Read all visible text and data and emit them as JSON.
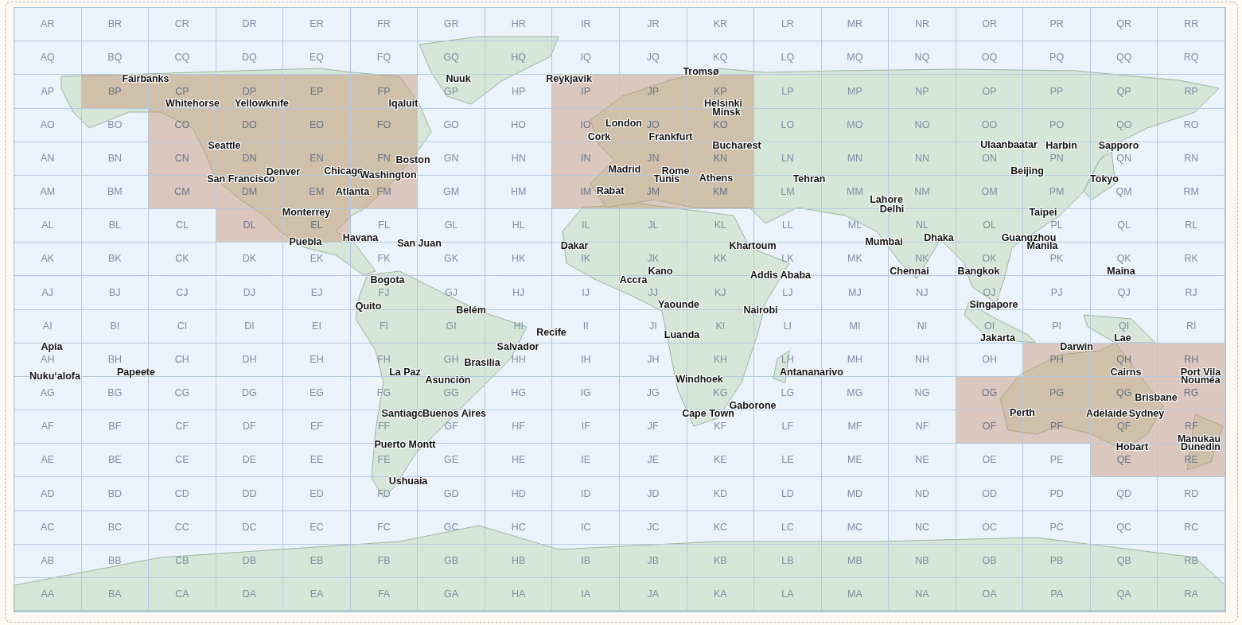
{
  "grid": {
    "rows": [
      {
        "labels": [
          "AR",
          "BR",
          "CR",
          "DR",
          "ER",
          "FR",
          "GR",
          "HR",
          "IR",
          "JR",
          "KR",
          "LR",
          "MR",
          "NR",
          "OR",
          "PR",
          "QR",
          "RR"
        ],
        "highlighted": [
          false,
          false,
          false,
          false,
          false,
          false,
          false,
          false,
          false,
          false,
          false,
          false,
          false,
          false,
          false,
          false,
          false,
          false
        ]
      },
      {
        "labels": [
          "AQ",
          "BQ",
          "CQ",
          "DQ",
          "EQ",
          "FQ",
          "GQ",
          "HQ",
          "IQ",
          "JQ",
          "KQ",
          "LQ",
          "MQ",
          "NQ",
          "OQ",
          "PQ",
          "QQ",
          "RQ"
        ],
        "highlighted": [
          false,
          false,
          false,
          false,
          false,
          false,
          false,
          false,
          false,
          false,
          false,
          false,
          false,
          false,
          false,
          false,
          false,
          false
        ]
      },
      {
        "labels": [
          "AP",
          "BP",
          "CP",
          "DP",
          "EP",
          "FP",
          "GP",
          "HP",
          "IP",
          "JP",
          "KP",
          "LP",
          "MP",
          "NP",
          "OP",
          "PP",
          "QP",
          "RP"
        ],
        "highlighted": [
          false,
          true,
          true,
          true,
          true,
          true,
          false,
          false,
          true,
          true,
          true,
          false,
          false,
          false,
          false,
          false,
          false,
          false
        ]
      },
      {
        "labels": [
          "AO",
          "BO",
          "CO",
          "DO",
          "EO",
          "FO",
          "GO",
          "HO",
          "IO",
          "JO",
          "KO",
          "LO",
          "MO",
          "NO",
          "OO",
          "PO",
          "QO",
          "RO"
        ],
        "highlighted": [
          false,
          false,
          true,
          true,
          true,
          true,
          false,
          false,
          true,
          true,
          true,
          false,
          false,
          false,
          false,
          false,
          false,
          false
        ]
      },
      {
        "labels": [
          "AN",
          "BN",
          "CN",
          "DN",
          "EN",
          "FN",
          "GN",
          "HN",
          "IN",
          "JN",
          "KN",
          "LN",
          "MN",
          "NN",
          "ON",
          "PN",
          "QN",
          "RN"
        ],
        "highlighted": [
          false,
          false,
          true,
          true,
          true,
          true,
          false,
          false,
          true,
          true,
          true,
          false,
          false,
          false,
          false,
          false,
          false,
          false
        ]
      },
      {
        "labels": [
          "AM",
          "BM",
          "CM",
          "DM",
          "EM",
          "FM",
          "GM",
          "HM",
          "IM",
          "JM",
          "KM",
          "LM",
          "MM",
          "NM",
          "OM",
          "PM",
          "QM",
          "RM"
        ],
        "highlighted": [
          false,
          false,
          true,
          true,
          true,
          true,
          false,
          false,
          true,
          true,
          true,
          false,
          false,
          false,
          false,
          false,
          false,
          false
        ]
      },
      {
        "labels": [
          "AL",
          "BL",
          "CL",
          "DL",
          "EL",
          "FL",
          "GL",
          "HL",
          "IL",
          "JL",
          "KL",
          "LL",
          "ML",
          "NL",
          "OL",
          "PL",
          "QL",
          "RL"
        ],
        "highlighted": [
          false,
          false,
          false,
          true,
          true,
          false,
          false,
          false,
          false,
          false,
          false,
          false,
          false,
          false,
          false,
          false,
          false,
          false
        ]
      },
      {
        "labels": [
          "AK",
          "BK",
          "CK",
          "DK",
          "EK",
          "FK",
          "GK",
          "HK",
          "IK",
          "JK",
          "KK",
          "LK",
          "MK",
          "NK",
          "OK",
          "PK",
          "QK",
          "RK"
        ],
        "highlighted": [
          false,
          false,
          false,
          false,
          false,
          false,
          false,
          false,
          false,
          false,
          false,
          false,
          false,
          false,
          false,
          false,
          false,
          false
        ]
      },
      {
        "labels": [
          "AJ",
          "BJ",
          "CJ",
          "DJ",
          "EJ",
          "FJ",
          "GJ",
          "HJ",
          "IJ",
          "JJ",
          "KJ",
          "LJ",
          "MJ",
          "NJ",
          "OJ",
          "PJ",
          "QJ",
          "RJ"
        ],
        "highlighted": [
          false,
          false,
          false,
          false,
          false,
          false,
          false,
          false,
          false,
          false,
          false,
          false,
          false,
          false,
          false,
          false,
          false,
          false
        ]
      },
      {
        "labels": [
          "AI",
          "BI",
          "CI",
          "DI",
          "EI",
          "FI",
          "GI",
          "HI",
          "II",
          "JI",
          "KI",
          "LI",
          "MI",
          "NI",
          "OI",
          "PI",
          "QI",
          "RI"
        ],
        "highlighted": [
          false,
          false,
          false,
          false,
          false,
          false,
          false,
          false,
          false,
          false,
          false,
          false,
          false,
          false,
          false,
          false,
          false,
          false
        ]
      },
      {
        "labels": [
          "AH",
          "BH",
          "CH",
          "DH",
          "EH",
          "FH",
          "GH",
          "HH",
          "IH",
          "JH",
          "KH",
          "LH",
          "MH",
          "NH",
          "OH",
          "PH",
          "QH",
          "RH"
        ],
        "highlighted": [
          false,
          false,
          false,
          false,
          false,
          false,
          false,
          false,
          false,
          false,
          false,
          false,
          false,
          false,
          false,
          true,
          true,
          true
        ]
      },
      {
        "labels": [
          "AG",
          "BG",
          "CG",
          "DG",
          "EG",
          "FG",
          "GG",
          "HG",
          "IG",
          "JG",
          "KG",
          "LG",
          "MG",
          "NG",
          "OG",
          "PG",
          "QG",
          "RG"
        ],
        "highlighted": [
          false,
          false,
          false,
          false,
          false,
          false,
          false,
          false,
          false,
          false,
          false,
          false,
          false,
          false,
          true,
          true,
          true,
          true
        ]
      },
      {
        "labels": [
          "AF",
          "BF",
          "CF",
          "DF",
          "EF",
          "FF",
          "GF",
          "HF",
          "IF",
          "JF",
          "KF",
          "LF",
          "MF",
          "NF",
          "OF",
          "PF",
          "QF",
          "RF"
        ],
        "highlighted": [
          false,
          false,
          false,
          false,
          false,
          false,
          false,
          false,
          false,
          false,
          false,
          false,
          false,
          false,
          true,
          true,
          true,
          true
        ]
      },
      {
        "labels": [
          "AE",
          "BE",
          "CE",
          "DE",
          "EE",
          "FE",
          "GE",
          "HE",
          "IE",
          "JE",
          "KE",
          "LE",
          "ME",
          "NE",
          "OE",
          "PE",
          "QE",
          "RE"
        ],
        "highlighted": [
          false,
          false,
          false,
          false,
          false,
          false,
          false,
          false,
          false,
          false,
          false,
          false,
          false,
          false,
          false,
          false,
          true,
          true
        ]
      },
      {
        "labels": [
          "AD",
          "BD",
          "CD",
          "DD",
          "ED",
          "FD",
          "GD",
          "HD",
          "ID",
          "JD",
          "KD",
          "LD",
          "MD",
          "ND",
          "OD",
          "PD",
          "QD",
          "RD"
        ],
        "highlighted": [
          false,
          false,
          false,
          false,
          false,
          false,
          false,
          false,
          false,
          false,
          false,
          false,
          false,
          false,
          false,
          false,
          false,
          false
        ]
      },
      {
        "labels": [
          "AC",
          "BC",
          "CC",
          "DC",
          "EC",
          "FC",
          "GC",
          "HC",
          "IC",
          "JC",
          "KC",
          "LC",
          "MC",
          "NC",
          "OC",
          "PC",
          "QC",
          "RC"
        ],
        "highlighted": [
          false,
          false,
          false,
          false,
          false,
          false,
          false,
          false,
          false,
          false,
          false,
          false,
          false,
          false,
          false,
          false,
          false,
          false
        ]
      },
      {
        "labels": [
          "AB",
          "BB",
          "CB",
          "DB",
          "EB",
          "FB",
          "GB",
          "HB",
          "IB",
          "JB",
          "KB",
          "LB",
          "MB",
          "NB",
          "OB",
          "PB",
          "QB",
          "RB"
        ],
        "highlighted": [
          false,
          false,
          false,
          false,
          false,
          false,
          false,
          false,
          false,
          false,
          false,
          false,
          false,
          false,
          false,
          false,
          false,
          false
        ]
      },
      {
        "labels": [
          "AA",
          "BA",
          "CA",
          "DA",
          "EA",
          "FA",
          "GA",
          "HA",
          "IA",
          "JA",
          "KA",
          "LA",
          "MA",
          "NA",
          "OA",
          "PA",
          "QA",
          "RA"
        ],
        "highlighted": [
          false,
          false,
          false,
          false,
          false,
          false,
          false,
          false,
          false,
          false,
          false,
          false,
          false,
          false,
          false,
          false,
          false,
          false
        ]
      }
    ]
  },
  "cities": [
    "Fairbanks",
    "Whitehorse",
    "Yellowknife",
    "Iqaluit",
    "Nuuk",
    "Reykjavik",
    "Tromsø",
    "Helsinki",
    "Cork",
    "London",
    "Minsk",
    "Frankfurt",
    "Seattle",
    "Bucharest",
    "Ulaanbaatar",
    "Harbin",
    "Chicago",
    "Boston",
    "Sapporo",
    "San Francisco",
    "Denver",
    "Washington",
    "Madrid",
    "Rome",
    "Tunis",
    "Athens",
    "Beijing",
    "Tehran",
    "Atlanta",
    "Rabat",
    "Tokyo",
    "Lahore",
    "Delhi",
    "Monterrey",
    "Taipei",
    "Puebla",
    "Havana",
    "San Juan",
    "Dakar",
    "Khartoum",
    "Mumbai",
    "Dhaka",
    "Guangzhou",
    "Manila",
    "Bogota",
    "Accra",
    "Kano",
    "Addis Ababa",
    "Chennai",
    "Bangkok",
    "Maina",
    "Quito",
    "Belém",
    "Yaounde",
    "Nairobi",
    "Singapore",
    "Recife",
    "Luanda",
    "Jakarta",
    "Lae",
    "Apia",
    "Salvador",
    "Darwin",
    "Nuku‘alofa",
    "Papeete",
    "La Paz",
    "Asunción",
    "Brasilia",
    "Windhoek",
    "Antananarivo",
    "Cairns",
    "Port Vila",
    "Nouméa",
    "Gaborone",
    "Brisbane",
    "Santiago",
    "Buenos Aires",
    "Cape Town",
    "Perth",
    "Adelaide",
    "Sydney",
    "Puerto Montt",
    "Manukau",
    "Hobart",
    "Dunedin",
    "Ushuaia"
  ]
}
